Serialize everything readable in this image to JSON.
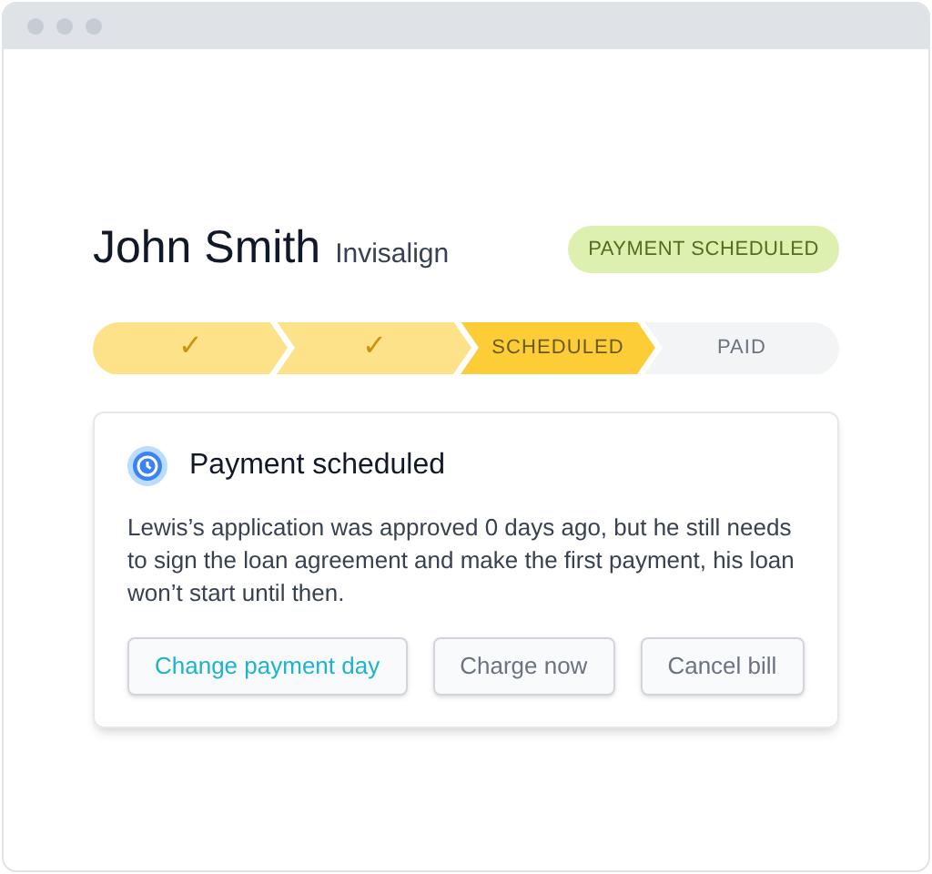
{
  "customer": {
    "name": "John Smith",
    "product": "Invisalign"
  },
  "status_badge": "PAYMENT SCHEDULED",
  "steps": [
    {
      "kind": "done",
      "label": "✓"
    },
    {
      "kind": "done",
      "label": "✓"
    },
    {
      "kind": "current",
      "label": "SCHEDULED"
    },
    {
      "kind": "pending",
      "label": "PAID"
    }
  ],
  "card": {
    "title": "Payment scheduled",
    "message": "Lewis’s application was approved 0 days ago, but he still needs to sign the loan agreement and make the first payment, his loan won’t start until then.",
    "buttons": [
      {
        "label": "Change payment day",
        "kind": "primary"
      },
      {
        "label": "Charge now",
        "kind": "secondary"
      },
      {
        "label": "Cancel bill",
        "kind": "secondary"
      }
    ]
  }
}
